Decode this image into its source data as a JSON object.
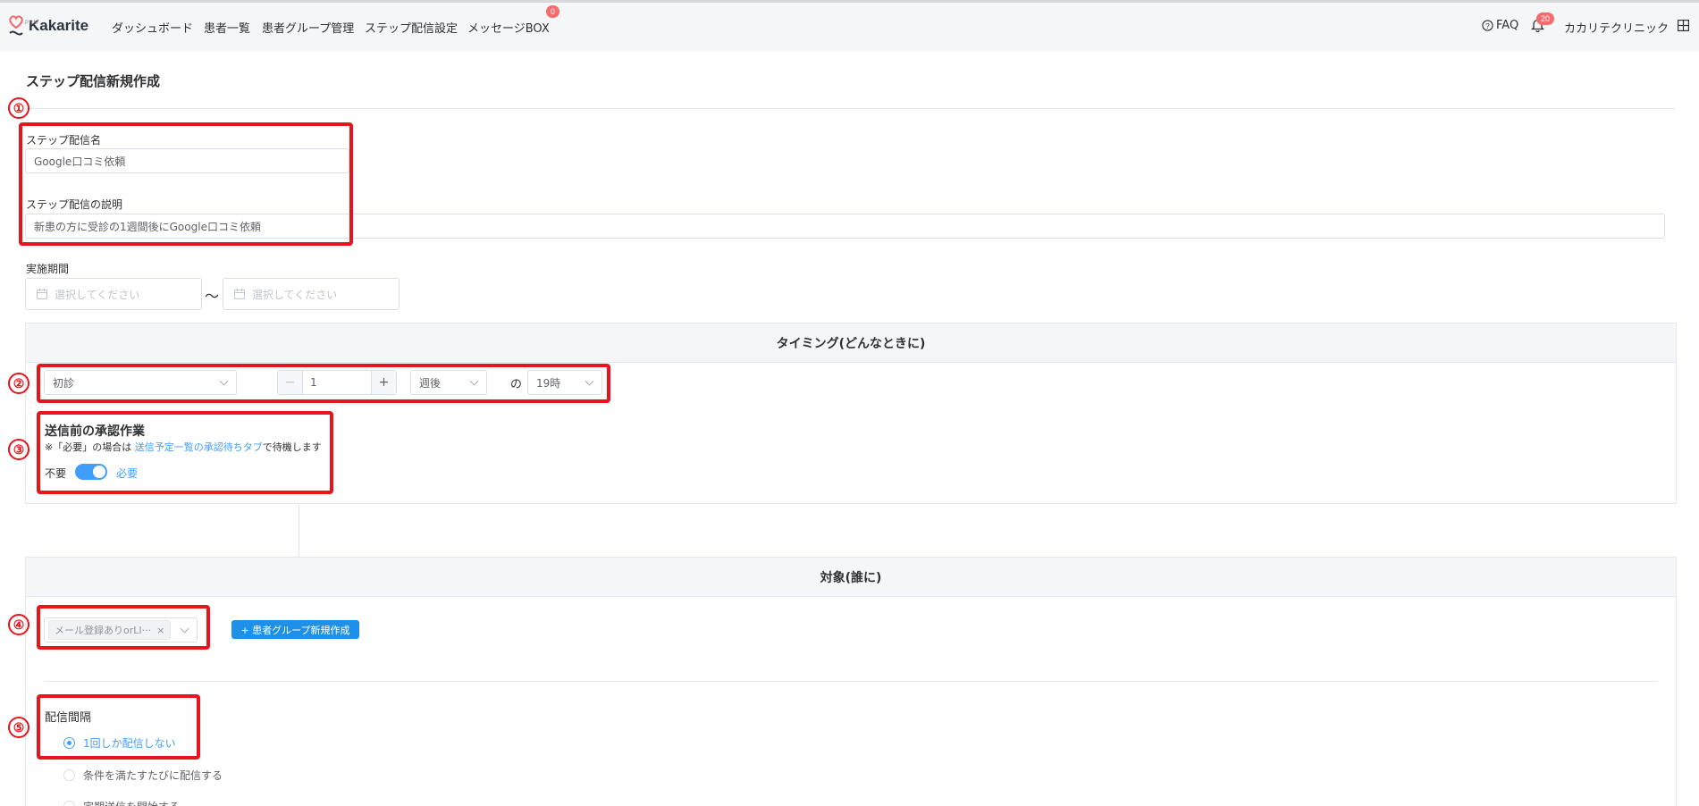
{
  "header": {
    "logo_text": "Kakarite",
    "logo_sub": "PRM",
    "nav": [
      {
        "label": "ダッシュボード"
      },
      {
        "label": "患者一覧"
      },
      {
        "label": "患者グループ管理"
      },
      {
        "label": "ステップ配信設定"
      },
      {
        "label": "メッセージBOX"
      }
    ],
    "message_badge": "0",
    "faq_label": "FAQ",
    "notification_badge": "20",
    "clinic_name": "カカリテクリニック"
  },
  "page": {
    "title": "ステップ配信新規作成"
  },
  "form": {
    "name_label": "ステップ配信名",
    "name_value": "Google口コミ依頼",
    "description_label": "ステップ配信の説明",
    "description_value": "新患の方に受診の1週間後にGoogle口コミ依頼",
    "period_label": "実施期間",
    "period_start_placeholder": "選択してください",
    "period_end_placeholder": "選択してください",
    "period_sep": "〜"
  },
  "timing": {
    "header": "タイミング(どんなときに)",
    "trigger_value": "初診",
    "count_value": "1",
    "unit_value": "週後",
    "no_label": "の",
    "time_value": "19時",
    "approval_title": "送信前の承認作業",
    "approval_note_prefix": "※「必要」の場合は ",
    "approval_note_link": "送信予定一覧の承認待ちタブ",
    "approval_note_suffix": "で待機します",
    "toggle_off_label": "不要",
    "toggle_on_label": "必要"
  },
  "target": {
    "header": "対象(誰に)",
    "group_tag": "メール登録ありorLI···",
    "new_group_button": "+ 患者グループ新規作成",
    "interval_label": "配信間隔",
    "interval_options": [
      {
        "label": "1回しか配信しない",
        "selected": true
      },
      {
        "label": "条件を満たすたびに配信する",
        "selected": false
      },
      {
        "label": "定期送信を開始する",
        "selected": false
      }
    ]
  },
  "markers": [
    "①",
    "②",
    "③",
    "④",
    "⑤"
  ],
  "colors": {
    "accent": "#409eff",
    "primary_button": "#1e90e8",
    "annotation_red": "#e8141b",
    "badge_red": "#f56c6c"
  }
}
